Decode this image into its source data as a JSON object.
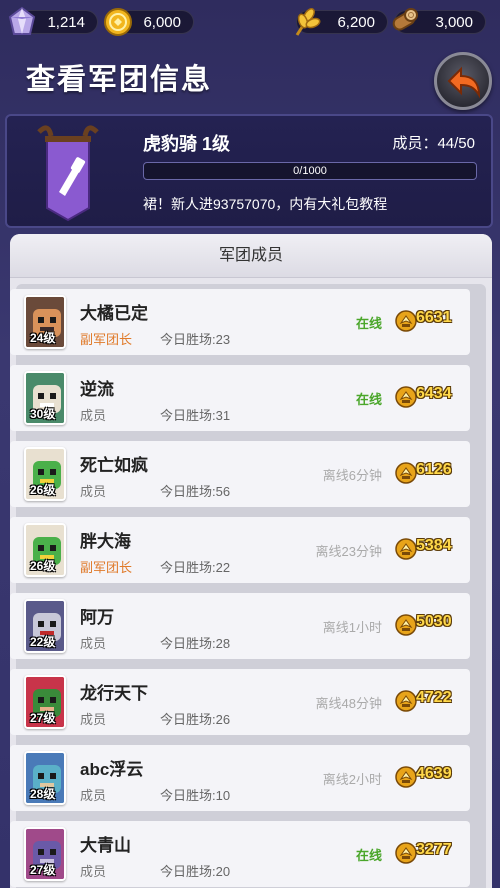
{
  "resources": {
    "gems": "1,214",
    "gold": "6,000",
    "food": "6,200",
    "wood": "3,000"
  },
  "header": {
    "title": "查看军团信息"
  },
  "legion": {
    "name": "虎豹骑 1级",
    "members_label": "成员：44/50",
    "exp_text": "0/1000",
    "exp_fraction": 0,
    "announcement": "裙！新人进93757070，内有大礼包教程"
  },
  "members_section": {
    "title": "军团成员"
  },
  "members": [
    {
      "name": "大橘已定",
      "level": "24级",
      "role": "副军团长",
      "wins": "今日胜场:23",
      "status": "在线",
      "power": "6631"
    },
    {
      "name": "逆流",
      "level": "30级",
      "role": "成员",
      "wins": "今日胜场:31",
      "status": "在线",
      "power": "6434"
    },
    {
      "name": "死亡如疯",
      "level": "26级",
      "role": "成员",
      "wins": "今日胜场:56",
      "status": "离线6分钟",
      "power": "6126"
    },
    {
      "name": "胖大海",
      "level": "26级",
      "role": "副军团长",
      "wins": "今日胜场:22",
      "status": "离线23分钟",
      "power": "5384"
    },
    {
      "name": "阿万",
      "level": "22级",
      "role": "成员",
      "wins": "今日胜场:28",
      "status": "离线1小时",
      "power": "5030"
    },
    {
      "name": "龙行天下",
      "level": "27级",
      "role": "成员",
      "wins": "今日胜场:26",
      "status": "离线48分钟",
      "power": "4722"
    },
    {
      "name": "abc浮云",
      "level": "28级",
      "role": "成员",
      "wins": "今日胜场:10",
      "status": "离线2小时",
      "power": "4639"
    },
    {
      "name": "大青山",
      "level": "27级",
      "role": "成员",
      "wins": "今日胜场:20",
      "status": "在线",
      "power": "3277"
    }
  ]
}
